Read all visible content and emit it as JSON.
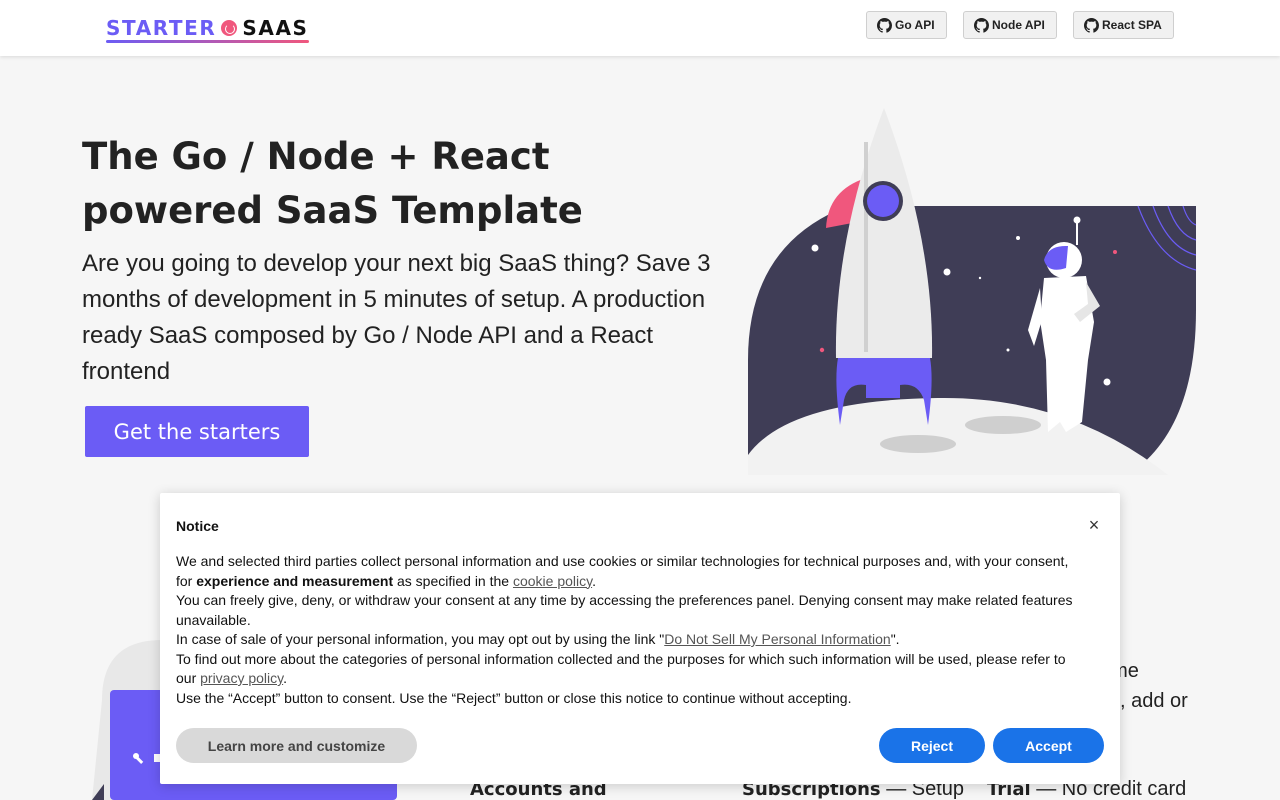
{
  "navbar": {
    "logo": {
      "part_a": "STARTER",
      "part_b": "SAAS"
    },
    "buttons": [
      {
        "label": "Go API",
        "icon": "github-icon"
      },
      {
        "label": "Node API",
        "icon": "github-icon"
      },
      {
        "label": "React SPA",
        "icon": "github-icon"
      }
    ]
  },
  "hero": {
    "title": "The Go / Node + React powered SaaS Template",
    "subtitle": "Are you going to develop your next big SaaS thing? Save 3 months of development in 5 minutes of setup. A production ready SaaS composed by Go / Node API and a React frontend",
    "cta_label": "Get the starters"
  },
  "behind_content": {
    "fragment_1": "sume",
    "fragment_2": ", add or",
    "features": [
      {
        "bold": "Accounts and",
        "rest": ""
      },
      {
        "bold": "Subscriptions",
        "rest": " — Setup"
      },
      {
        "bold": "Trial",
        "rest": " — No credit card"
      }
    ]
  },
  "notice": {
    "title": "Notice",
    "close_label": "×",
    "p1_a": "We and selected third parties collect personal information and use cookies or similar technologies for technical purposes and, with your consent, for ",
    "p1_bold": "experience and measurement",
    "p1_b": " as specified in the ",
    "p1_link": "cookie policy",
    "p1_c": ".",
    "p2": "You can freely give, deny, or withdraw your consent at any time by accessing the preferences panel. Denying consent may make related features unavailable.",
    "p3_a": "In case of sale of your personal information, you may opt out by using the link \"",
    "p3_link": "Do Not Sell My Personal Information",
    "p3_b": "\".",
    "p4_a": "To find out more about the categories of personal information collected and the purposes for which such information will be used, please refer to our ",
    "p4_link": "privacy policy",
    "p4_b": ".",
    "p5": "Use the “Accept” button to consent. Use the “Reject” button or close this notice to continue without accepting.",
    "learn_label": "Learn more and customize",
    "reject_label": "Reject",
    "accept_label": "Accept"
  },
  "colors": {
    "brand": "#6b5cf5",
    "accent_pink": "#f0577d",
    "consent_blue": "#1a73e8",
    "illustration_dark": "#3f3d56"
  }
}
